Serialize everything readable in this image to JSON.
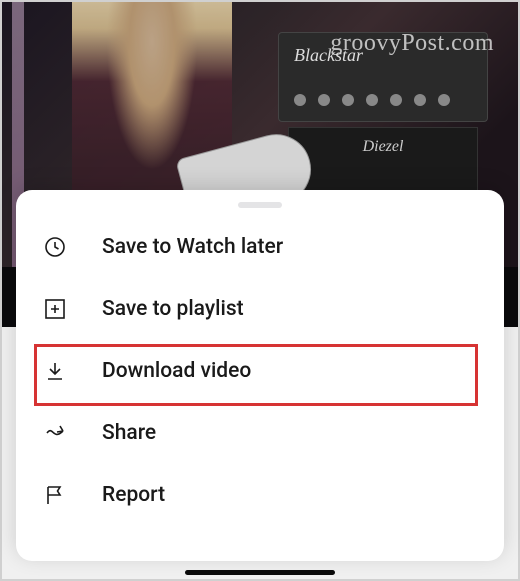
{
  "watermark": "groovyPost.com",
  "background": {
    "amp_brand": "Blackstar",
    "cabinet_brand": "Diezel"
  },
  "menu": {
    "items": [
      {
        "label": "Save to Watch later",
        "icon": "clock-icon"
      },
      {
        "label": "Save to playlist",
        "icon": "playlist-add-icon"
      },
      {
        "label": "Download video",
        "icon": "download-icon"
      },
      {
        "label": "Share",
        "icon": "share-icon"
      },
      {
        "label": "Report",
        "icon": "flag-icon"
      }
    ]
  },
  "highlight": {
    "index": 2,
    "color": "#d63333"
  }
}
